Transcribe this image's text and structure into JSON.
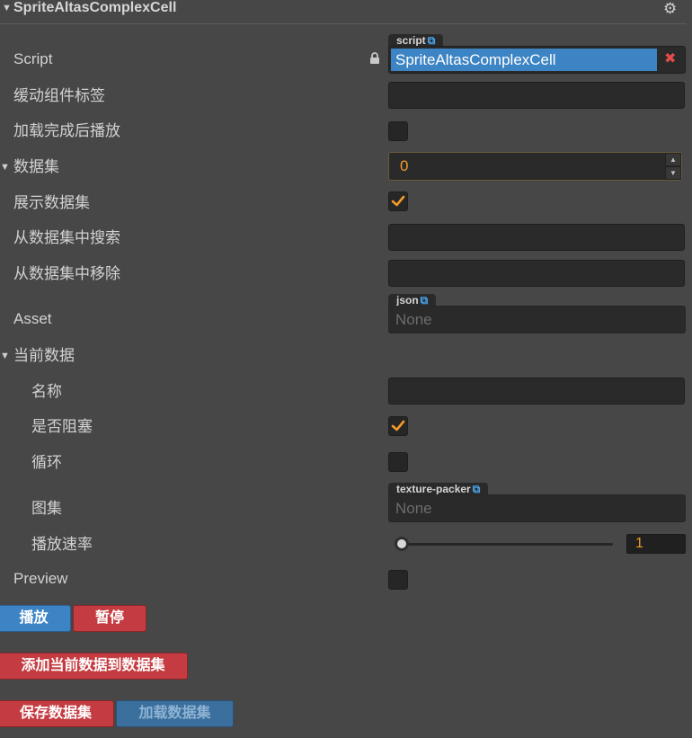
{
  "header": {
    "collapse_glyph": "▼",
    "title": "SpriteAltasComplexCell",
    "settings_icon": "gear-icon"
  },
  "fold_glyph": "▼",
  "script": {
    "label": "Script",
    "tag": "script",
    "value": "SpriteAltasComplexCell"
  },
  "fields": {
    "tween_tag": {
      "label": "缓动组件标签",
      "value": ""
    },
    "play_on_load": {
      "label": "加载完成后播放",
      "checked": false
    },
    "dataset": {
      "label": "数据集",
      "value": "0"
    },
    "show_dataset": {
      "label": "展示数据集",
      "checked": true
    },
    "search_dataset": {
      "label": "从数据集中搜索",
      "value": ""
    },
    "remove_from_dataset": {
      "label": "从数据集中移除",
      "value": ""
    },
    "asset": {
      "label": "Asset",
      "tag": "json",
      "value": "None"
    }
  },
  "current": {
    "label": "当前数据",
    "name": {
      "label": "名称",
      "value": ""
    },
    "block": {
      "label": "是否阻塞",
      "checked": true
    },
    "loop": {
      "label": "循环",
      "checked": false
    },
    "atlas": {
      "label": "图集",
      "tag": "texture-packer",
      "value": "None"
    },
    "speed": {
      "label": "播放速率",
      "value": "1",
      "fraction": 0
    }
  },
  "preview": {
    "label": "Preview",
    "checked": false
  },
  "buttons": {
    "play": "播放",
    "pause": "暂停",
    "add_current": "添加当前数据到数据集",
    "save_dataset": "保存数据集",
    "load_dataset": "加载数据集"
  },
  "colors": {
    "accent_blue": "#3c84c4",
    "accent_red": "#c43c41",
    "value_orange": "#f39a2a",
    "background": "#474747"
  }
}
